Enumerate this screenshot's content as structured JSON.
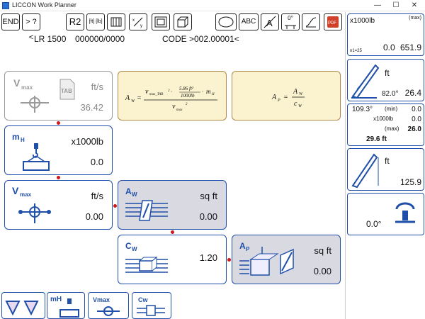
{
  "window": {
    "title": "LICCON Work Planner",
    "minimize_glyph": "—",
    "maximize_glyph": "☐",
    "close_glyph": "✕"
  },
  "toolbar": {
    "end_label": "END",
    "goto_label": "> ? <",
    "r2_label": "R2",
    "units_label": "[ft] [lb]",
    "abc_label": "ABC",
    "angle_label": "0°",
    "pdf_label": "PDF"
  },
  "header": {
    "crane": "LR 1500",
    "number": "000000/0000",
    "code": "CODE >002.00001<"
  },
  "panels": {
    "vmax_tab": {
      "symbol": "Vmax",
      "tab": "TAB",
      "unit": "ft/s",
      "value": "36.42"
    },
    "formula_aw": {
      "lhs": "A",
      "lhs_sub": "W",
      "num": "v",
      "num_sub": "max_TAB",
      "coef_num": "5.86 ft²",
      "coef_den": "1000lb",
      "mass": "m",
      "mass_sub": "H",
      "den": "v",
      "den_sub": "max"
    },
    "formula_ap": {
      "lhs": "A",
      "lhs_sub": "P",
      "num": "A",
      "num_sub": "W",
      "den": "c",
      "den_sub": "W"
    },
    "mh": {
      "symbol": "mH",
      "unit": "x1000lb",
      "value": "0.0"
    },
    "vmax": {
      "symbol": "Vmax",
      "unit": "ft/s",
      "value": "0.00"
    },
    "aw": {
      "symbol": "Aw",
      "unit": "sq ft",
      "value": "0.00"
    },
    "cw": {
      "symbol": "Cw",
      "value": "1.20"
    },
    "ap": {
      "symbol": "Ap",
      "unit": "sq ft",
      "value": "0.00"
    }
  },
  "sidebar": {
    "load": {
      "unit": "x1000lb",
      "tag": "(max)",
      "small": "n1=25",
      "val1": "0.0",
      "val2": "651.9"
    },
    "radius": {
      "unit": "ft",
      "angle": "82.0°",
      "value": "26.4"
    },
    "range": {
      "angle": "109.3°",
      "unit": "x1000lb",
      "min_label": "(min)",
      "max_label": "(max)",
      "min_val": "0.0",
      "mid_val": "0.0",
      "max_val": "26.0",
      "radius": "29.6 ft"
    },
    "height": {
      "unit": "ft",
      "value": "125.9"
    },
    "slew": {
      "value": "0.0°"
    }
  },
  "bottombar": {
    "mh": "mH",
    "vmax": "Vmax",
    "cw": "Cw"
  }
}
